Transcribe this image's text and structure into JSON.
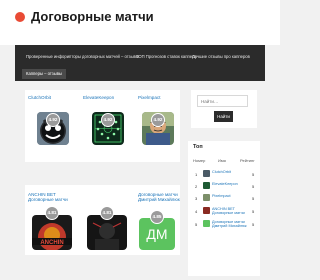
{
  "site": {
    "title": "Договорные матчи"
  },
  "nav": {
    "links": [
      "Проверенные инфорипторы договорных матчей – отзывы",
      "ТОП Прогнозов ставок каппера",
      "Лучшие отзывы про капперов"
    ],
    "active": "Капперы – отзывы"
  },
  "cards": [
    {
      "title": "ClutchOrbit",
      "score": "4.92"
    },
    {
      "title": "ElevateKeepon",
      "score": "4.92"
    },
    {
      "title": "Pixelmpact",
      "score": "4.92"
    },
    {
      "title": "ANCHIN BET Договорные матчи",
      "score": "4.81"
    },
    {
      "title": "",
      "score": "4.81"
    },
    {
      "title": "Договорные матчи Дмитрий Михайлюк",
      "score": "4.85",
      "avatar": "ДМ"
    }
  ],
  "search": {
    "placeholder": "Найти…",
    "button": "Найти"
  },
  "top": {
    "title": "Топ",
    "headers": {
      "rank": "Номер",
      "name": "Имя",
      "rating": "Рейтинг"
    },
    "rows": [
      {
        "rank": "1",
        "name": "ClutchOrbit",
        "rating": "5"
      },
      {
        "rank": "2",
        "name": "ElevateKeepon",
        "rating": "5"
      },
      {
        "rank": "3",
        "name": "Pixelmpact",
        "rating": "5"
      },
      {
        "rank": "4",
        "name": "ANCHIN BET Договорные матчи",
        "rating": "5"
      },
      {
        "rank": "5",
        "name": "Договорные матчи Дмитрий Михайлюк",
        "rating": "5"
      }
    ]
  },
  "colors": {
    "accent": "#1a73b8",
    "nav": "#2b2b2b",
    "brand_icon": "#e94b35",
    "avatar_green": "#5cc35f"
  }
}
